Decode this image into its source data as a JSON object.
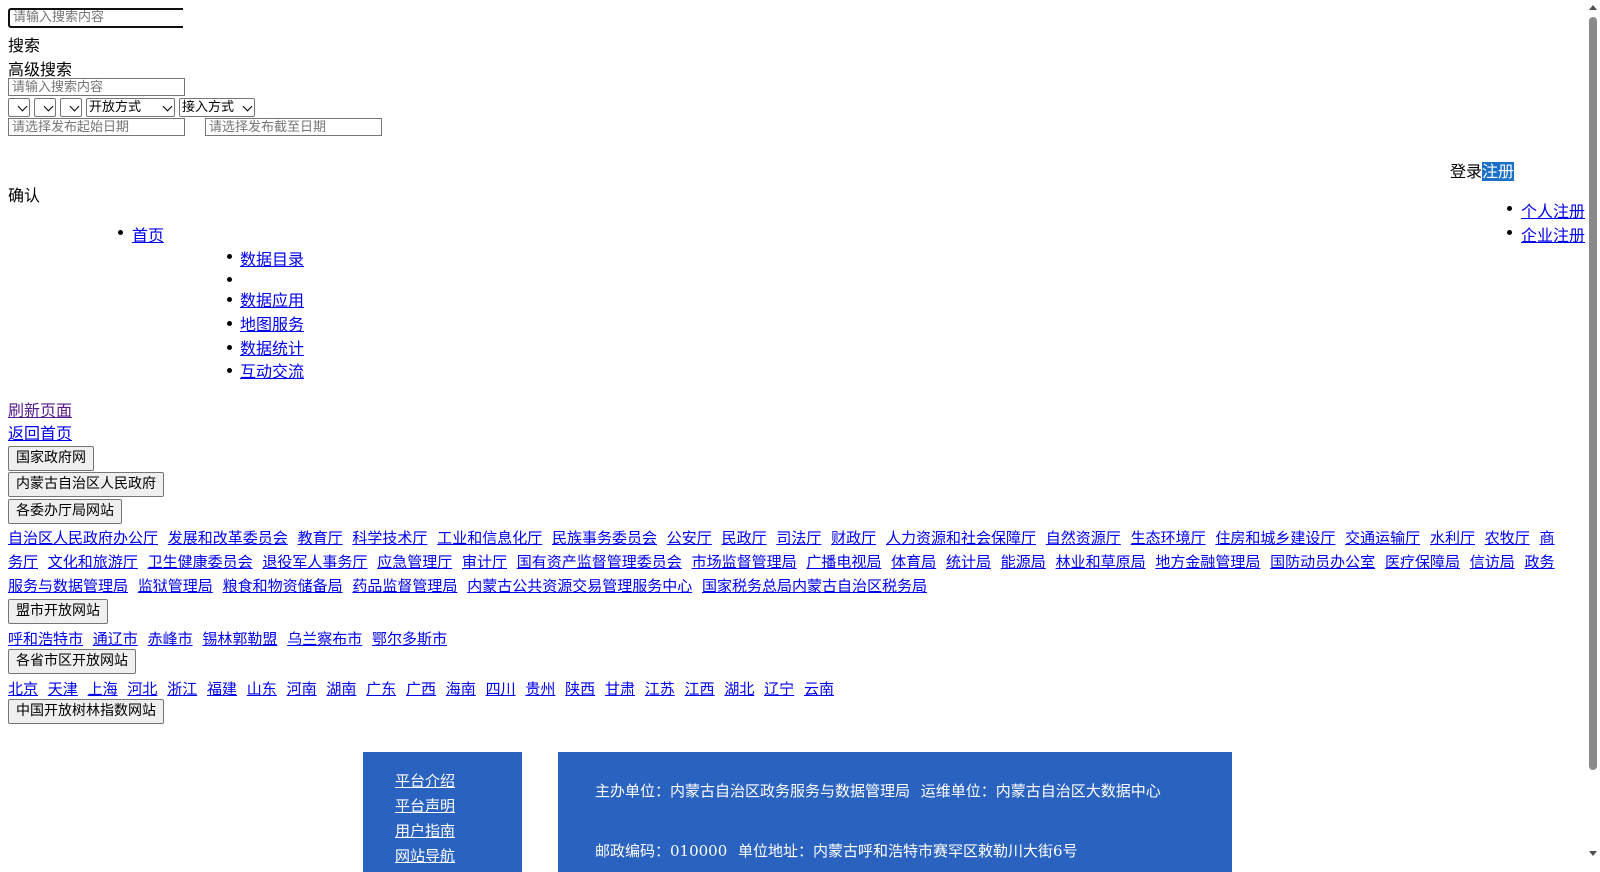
{
  "search": {
    "placeholder": "请输入搜索内容",
    "button": "搜索",
    "advanced_label": "高级搜索",
    "advanced_placeholder": "请输入搜索内容",
    "open_mode": "开放方式",
    "access_mode": "接入方式",
    "start_date_placeholder": "请选择发布起始日期",
    "end_date_placeholder": "请选择发布截至日期",
    "confirm": "确认"
  },
  "auth": {
    "login": "登录",
    "register": "注册",
    "register_menu": [
      "个人注册",
      "企业注册"
    ]
  },
  "nav": {
    "home": "首页",
    "items": [
      "数据目录",
      "",
      "数据应用",
      "地图服务",
      "数据统计",
      "互动交流"
    ]
  },
  "error_links": {
    "refresh": "刷新页面",
    "home": "返回首页"
  },
  "sites": {
    "national": "国家政府网",
    "region": "内蒙古自治区人民政府",
    "departments_title": "各委办厅局网站",
    "departments": [
      "自治区人民政府办公厅",
      "发展和改革委员会",
      "教育厅",
      "科学技术厅",
      "工业和信息化厅",
      "民族事务委员会",
      "公安厅",
      "民政厅",
      "司法厅",
      "财政厅",
      "人力资源和社会保障厅",
      "自然资源厅",
      "生态环境厅",
      "住房和城乡建设厅",
      "交通运输厅",
      "水利厅",
      "农牧厅",
      "商务厅",
      "文化和旅游厅",
      "卫生健康委员会",
      "退役军人事务厅",
      "应急管理厅",
      "审计厅",
      "国有资产监督管理委员会",
      "市场监督管理局",
      "广播电视局",
      "体育局",
      "统计局",
      "能源局",
      "林业和草原局",
      "地方金融管理局",
      "国防动员办公室",
      "医疗保障局",
      "信访局",
      "政务服务与数据管理局",
      "监狱管理局",
      "粮食和物资储备局",
      "药品监督管理局",
      "内蒙古公共资源交易管理服务中心",
      "国家税务总局内蒙古自治区税务局"
    ],
    "cities_title": "盟市开放网站",
    "cities": [
      "呼和浩特市",
      "通辽市",
      "赤峰市",
      "锡林郭勒盟",
      "乌兰察布市",
      "鄂尔多斯市"
    ],
    "provinces_title": "各省市区开放网站",
    "provinces": [
      "北京",
      "天津",
      "上海",
      "河北",
      "浙江",
      "福建",
      "山东",
      "河南",
      "湖南",
      "广东",
      "广西",
      "海南",
      "四川",
      "贵州",
      "陕西",
      "甘肃",
      "江苏",
      "江西",
      "湖北",
      "辽宁",
      "云南"
    ],
    "index_site": "中国开放树林指数网站"
  },
  "footer": {
    "links": [
      "平台介绍",
      "平台声明",
      "用户指南",
      "网站导航"
    ],
    "sponsor": "主办单位：内蒙古自治区政务服务与数据管理局",
    "operator": "运维单位：内蒙古自治区大数据中心",
    "postcode": "邮政编码：010000",
    "address": "单位地址：内蒙古呼和浩特市赛罕区敕勒川大街6号"
  }
}
